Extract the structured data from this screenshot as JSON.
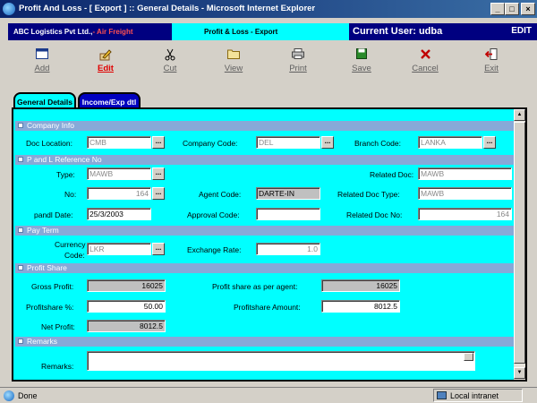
{
  "window": {
    "title": "Profit And Loss - [ Export ] :: General Details - Microsoft Internet Explorer"
  },
  "header": {
    "company": "ABC Logistics Pvt Ltd.,",
    "division": "- Air Freight",
    "module": "Profit & Loss -  Export",
    "user_label": "Current User: udba",
    "mode": "EDIT"
  },
  "toolbar": {
    "add": "Add",
    "edit": "Edit",
    "cut": "Cut",
    "view": "View",
    "print": "Print",
    "save": "Save",
    "cancel": "Cancel",
    "exit": "Exit"
  },
  "tabs": {
    "general": "General Details",
    "income": "Income/Exp dtl"
  },
  "sections": {
    "company_info": "Company Info",
    "pl_reference": "P and L  Reference No",
    "pay_term": "Pay Term",
    "profit_share": "Profit Share",
    "remarks": "Remarks"
  },
  "company_info": {
    "doc_location_label": "Doc Location:",
    "doc_location": "CMB",
    "company_code_label": "Company Code:",
    "company_code": "DEL",
    "branch_code_label": "Branch Code:",
    "branch_code": "LANKA"
  },
  "pl_reference": {
    "type_label": "Type:",
    "type": "MAWB",
    "related_doc_label": "Related Doc:",
    "related_doc": "MAWB",
    "no_label": "No:",
    "no": "164",
    "agent_code_label": "Agent Code:",
    "agent_code": "DARTE-IN",
    "related_doc_type_label": "Related Doc Type:",
    "related_doc_type": "MAWB",
    "pandl_date_label": "pandl Date:",
    "pandl_date": "25/3/2003",
    "approval_code_label": "Approval Code:",
    "approval_code": "",
    "related_doc_no_label": "Related Doc No:",
    "related_doc_no": "164"
  },
  "pay_term": {
    "currency_code_label_1": "Currency",
    "currency_code_label_2": "Code:",
    "currency_code": "LKR",
    "exchange_rate_label": "Exchange Rate:",
    "exchange_rate": "1.0"
  },
  "profit_share": {
    "gross_profit_label": "Gross Profit:",
    "gross_profit": "16025",
    "per_agent_label": "Profit share as per agent:",
    "per_agent": "16025",
    "percent_label": "Profitshare %:",
    "percent": "50.00",
    "amount_label": "Profitshare Amount:",
    "amount": "8012.5",
    "net_profit_label": "Net Profit:",
    "net_profit": "8012.5"
  },
  "remarks": {
    "remarks_label": "Remarks:"
  },
  "status": {
    "text": "Done",
    "zone": "Local intranet"
  },
  "colors": {
    "form_bg": "#00ffff",
    "header_navy": "#000080",
    "section_bar": "#87a9d8",
    "accent_red": "#e00000"
  },
  "icons": {
    "add": "window-icon",
    "edit": "pencil-icon",
    "cut": "scissors-icon",
    "view": "folder-icon",
    "print": "printer-icon",
    "save": "disk-icon",
    "cancel": "x-icon",
    "exit": "door-exit-icon"
  }
}
